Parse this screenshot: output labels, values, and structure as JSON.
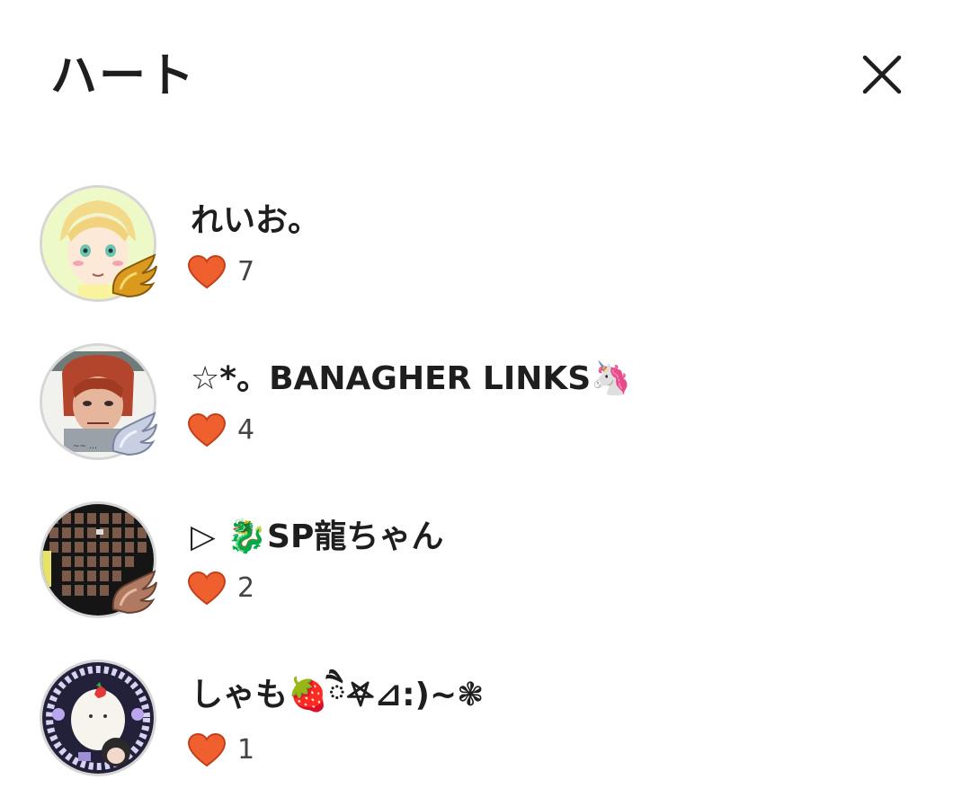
{
  "header": {
    "title": "ハート",
    "close_icon": "close-icon"
  },
  "colors": {
    "heart": "#f0602e",
    "heart_outline": "#c2401c",
    "text": "#1e1e1e",
    "count": "#444444"
  },
  "users": [
    {
      "name": "れいお。",
      "hearts": "7",
      "avatar": "avatar-anime-blond",
      "badge": "gold-wing-badge"
    },
    {
      "name": "☆*。BANAGHER LINKS🦄",
      "hearts": "4",
      "avatar": "avatar-drawing-redhair",
      "badge": "silver-wing-badge"
    },
    {
      "name": "▷ 🐉SP龍ちゃん",
      "hearts": "2",
      "avatar": "avatar-photo-collage",
      "badge": "bronze-wing-badge"
    },
    {
      "name": "しゃも🍓ཻ𖤐⊿:)~❃",
      "hearts": "1",
      "avatar": "avatar-ghost-strawberry",
      "badge": ""
    }
  ]
}
